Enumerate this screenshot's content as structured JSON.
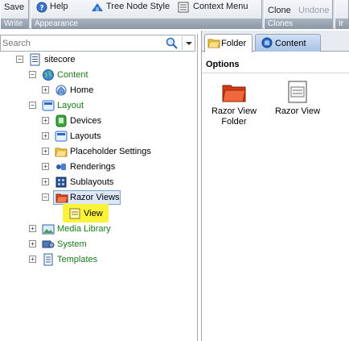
{
  "ribbon": {
    "save_label": "Save",
    "write_footer": "Write",
    "help_label": "Help",
    "tree_node_style_label": "Tree Node Style",
    "context_menu_label": "Context Menu",
    "appearance_footer": "Appearance",
    "clone_label": "Clone",
    "undone_label": "Undone",
    "clones_footer": "Clones",
    "extra_footer": "Ir"
  },
  "search": {
    "placeholder": "Search"
  },
  "tree": {
    "nodes": [
      {
        "label": "sitecore",
        "icon": "sitecore-root-icon"
      },
      {
        "label": "Content",
        "icon": "content-globe-icon"
      },
      {
        "label": "Home",
        "icon": "home-icon"
      },
      {
        "label": "Layout",
        "icon": "layout-icon"
      },
      {
        "label": "Devices",
        "icon": "devices-icon"
      },
      {
        "label": "Layouts",
        "icon": "layouts-icon"
      },
      {
        "label": "Placeholder Settings",
        "icon": "placeholder-folder-icon"
      },
      {
        "label": "Renderings",
        "icon": "renderings-icon"
      },
      {
        "label": "Sublayouts",
        "icon": "sublayouts-icon"
      },
      {
        "label": "Razor Views",
        "icon": "razor-views-folder-icon"
      },
      {
        "label": "View",
        "icon": "view-icon"
      },
      {
        "label": "Media Library",
        "icon": "media-library-icon"
      },
      {
        "label": "System",
        "icon": "system-icon"
      },
      {
        "label": "Templates",
        "icon": "templates-icon"
      }
    ]
  },
  "tabs": [
    {
      "label": "Folder",
      "icon": "folder-icon"
    },
    {
      "label": "Content",
      "icon": "content-tab-icon"
    }
  ],
  "options": {
    "title": "Options",
    "items": [
      {
        "label_line1": "Razor View",
        "label_line2": "Folder",
        "icon": "razor-view-folder-icon"
      },
      {
        "label_line1": "Razor View",
        "label_line2": "",
        "icon": "razor-view-icon"
      }
    ]
  },
  "colors": {
    "selection_bg": "#dce8f6",
    "highlight_yellow": "#fbf23a",
    "green_label": "#1a7a1a"
  }
}
